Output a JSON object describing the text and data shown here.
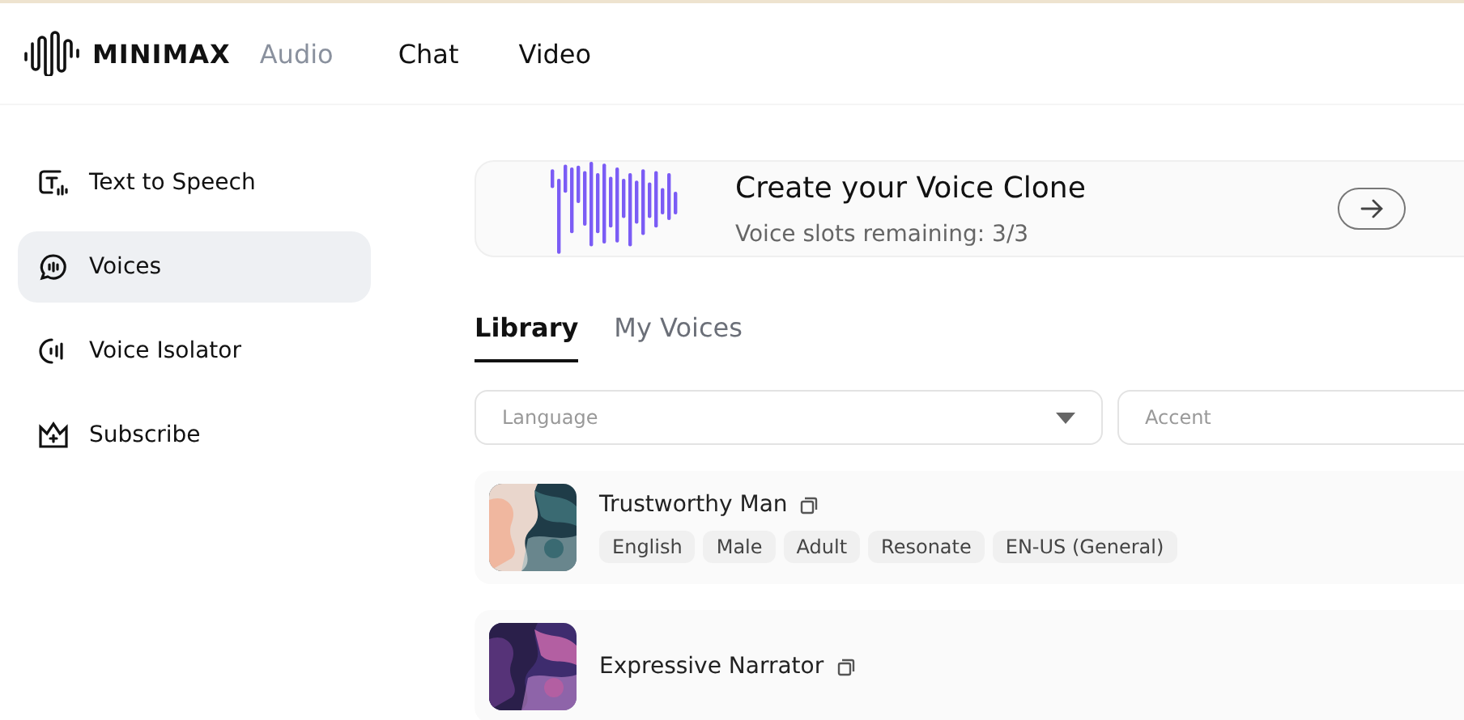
{
  "header": {
    "brand": "MINIMAX",
    "nav": [
      {
        "label": "Audio",
        "selected": true
      },
      {
        "label": "Chat",
        "selected": false
      },
      {
        "label": "Video",
        "selected": false
      }
    ]
  },
  "sidebar": {
    "items": [
      {
        "kind": "tts",
        "label": "Text to Speech",
        "selected": false
      },
      {
        "kind": "voices",
        "label": "Voices",
        "selected": true
      },
      {
        "kind": "isolator",
        "label": "Voice Isolator",
        "selected": false
      },
      {
        "kind": "subscribe",
        "label": "Subscribe",
        "selected": false
      }
    ]
  },
  "clone_card": {
    "title": "Create your Voice Clone",
    "subtitle": "Voice slots remaining: 3/3"
  },
  "tabs": [
    {
      "label": "Library",
      "selected": true
    },
    {
      "label": "My Voices",
      "selected": false
    }
  ],
  "filters": [
    {
      "placeholder": "Language",
      "dropdown": true
    },
    {
      "placeholder": "Accent"
    }
  ],
  "voices": [
    {
      "name": "Trustworthy Man",
      "tags": [
        "English",
        "Male",
        "Adult",
        "Resonate",
        "EN-US (General)"
      ]
    },
    {
      "name": "Expressive Narrator"
    }
  ]
}
